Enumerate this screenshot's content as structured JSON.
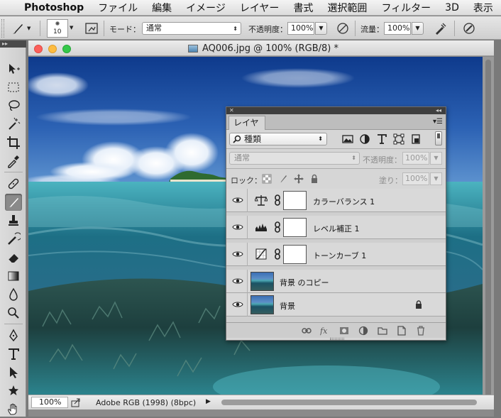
{
  "menubar": {
    "app_name": "Photoshop",
    "menus": [
      "ファイル",
      "編集",
      "イメージ",
      "レイヤー",
      "書式",
      "選択範囲",
      "フィルター",
      "3D",
      "表示"
    ]
  },
  "options_bar": {
    "brush_size": "10",
    "mode_label": "モード：",
    "mode_value": "通常",
    "opacity_label": "不透明度：",
    "opacity_value": "100%",
    "flow_label": "流量：",
    "flow_value": "100%"
  },
  "document": {
    "title": "AQ006.jpg @ 100% (RGB/8) *",
    "zoom": "100%",
    "color_profile": "Adobe RGB (1998) (8bpc)"
  },
  "layers_panel": {
    "tab_label": "レイヤー",
    "filter_kind": "種類",
    "blend_mode": "通常",
    "opacity_label": "不透明度：",
    "opacity_value": "100%",
    "lock_label": "ロック：",
    "fill_label": "塗り：",
    "fill_value": "100%",
    "layers": [
      {
        "name": "カラーバランス 1",
        "type": "adjustment",
        "adjustment_icon": "balance-scale-icon",
        "visible": true
      },
      {
        "name": "レベル補正 1",
        "type": "adjustment",
        "adjustment_icon": "histogram-icon",
        "visible": true
      },
      {
        "name": "トーンカーブ 1",
        "type": "adjustment",
        "adjustment_icon": "curves-icon",
        "visible": true
      },
      {
        "name": "背景 のコピー",
        "type": "image",
        "visible": true
      },
      {
        "name": "背景",
        "type": "image",
        "visible": true,
        "locked": true
      }
    ]
  },
  "tools": [
    "move-icon",
    "marquee-icon",
    "lasso-icon",
    "magic-wand-icon",
    "crop-icon",
    "eyedropper-icon",
    "healing-brush-icon",
    "brush-icon",
    "clone-stamp-icon",
    "history-brush-icon",
    "eraser-icon",
    "gradient-icon",
    "blur-icon",
    "dodge-icon",
    "pen-icon",
    "type-icon",
    "path-selection-icon",
    "shape-icon",
    "hand-icon"
  ],
  "colors": {
    "close": "#fc605b",
    "minimize": "#fdbc40",
    "zoom": "#34c84a"
  }
}
